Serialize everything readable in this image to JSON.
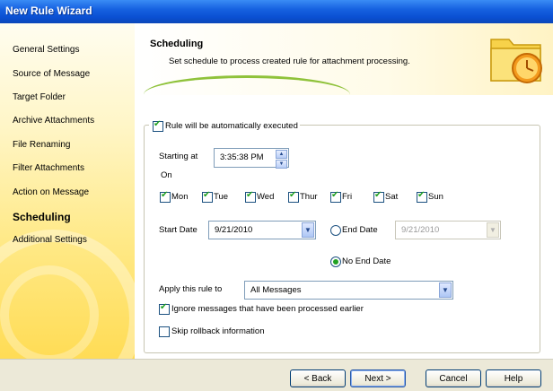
{
  "window": {
    "title": "New Rule Wizard"
  },
  "sidebar": {
    "items": [
      {
        "label": "General Settings"
      },
      {
        "label": "Source of Message"
      },
      {
        "label": "Target Folder"
      },
      {
        "label": "Archive Attachments"
      },
      {
        "label": "File Renaming"
      },
      {
        "label": "Filter Attachments"
      },
      {
        "label": "Action on Message"
      },
      {
        "label": "Scheduling",
        "active": true
      },
      {
        "label": "Additional Settings"
      }
    ]
  },
  "header": {
    "title": "Scheduling",
    "description": "Set schedule to process created rule for attachment processing.",
    "icon": "folder-clock-icon"
  },
  "form": {
    "auto_execute": {
      "label": "Rule will be automatically executed",
      "checked": true
    },
    "starting_at": {
      "label": "Starting at",
      "value": "3:35:38 PM"
    },
    "on_label": "On",
    "days": [
      {
        "label": "Mon",
        "checked": true
      },
      {
        "label": "Tue",
        "checked": true
      },
      {
        "label": "Wed",
        "checked": true
      },
      {
        "label": "Thur",
        "checked": true
      },
      {
        "label": "Fri",
        "checked": true
      },
      {
        "label": "Sat",
        "checked": true
      },
      {
        "label": "Sun",
        "checked": true
      }
    ],
    "start_date": {
      "label": "Start Date",
      "value": "9/21/2010"
    },
    "end_date": {
      "label": "End Date",
      "value": "9/21/2010",
      "selected": false
    },
    "no_end_date": {
      "label": "No End Date",
      "selected": true
    },
    "apply_rule": {
      "label": "Apply this rule to",
      "value": "All Messages"
    },
    "ignore_processed": {
      "label": "Ignore messages that have been processed earlier",
      "checked": true
    },
    "skip_rollback": {
      "label": "Skip rollback information",
      "checked": false
    }
  },
  "buttons": {
    "back": "< Back",
    "next": "Next >",
    "cancel": "Cancel",
    "help": "Help"
  }
}
